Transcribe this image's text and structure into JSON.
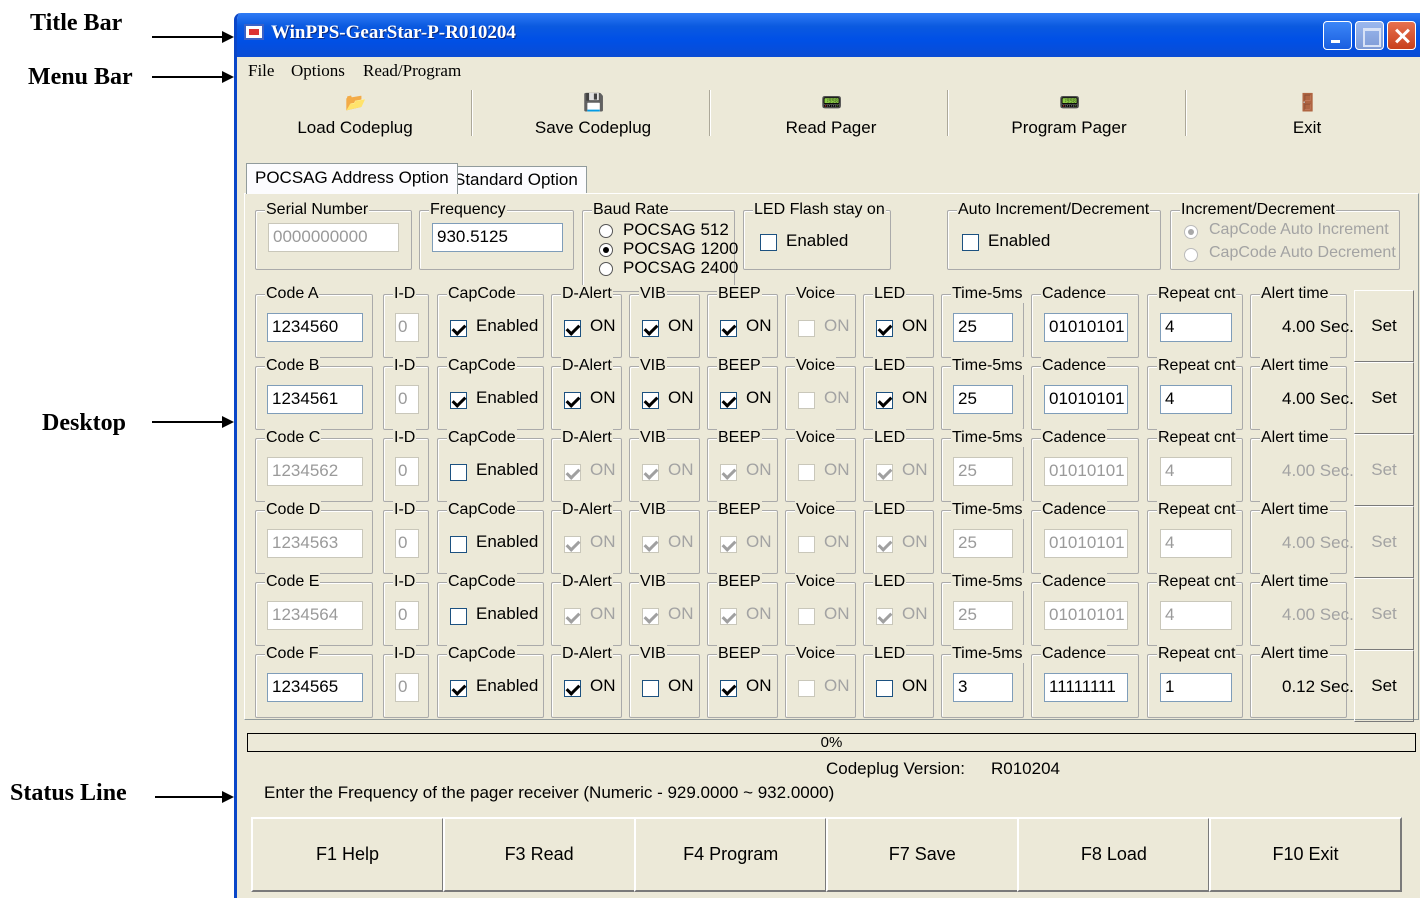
{
  "annotations": {
    "title_bar": "Title Bar",
    "menu_bar": "Menu Bar",
    "desktop": "Desktop",
    "status_line": "Status Line"
  },
  "window": {
    "title": "WinPPS-GearStar-P-R010204"
  },
  "menu": {
    "file": "File",
    "options": "Options",
    "read_program": "Read/Program"
  },
  "toolbar": {
    "load": "Load Codeplug",
    "save": "Save Codeplug",
    "read": "Read Pager",
    "program": "Program Pager",
    "exit": "Exit"
  },
  "tabs": {
    "pocsag": "POCSAG Address Option",
    "standard": "Standard Option"
  },
  "settings": {
    "serial_label": "Serial Number",
    "serial_value": "0000000000",
    "frequency_label": "Frequency",
    "frequency_value": "930.5125",
    "baud_label": "Baud Rate",
    "baud_options": [
      "POCSAG 512",
      "POCSAG 1200",
      "POCSAG 2400"
    ],
    "baud_selected": "POCSAG 1200",
    "led_label": "LED Flash stay on",
    "led_text": "Enabled",
    "led_enabled": false,
    "auto_label": "Auto Increment/Decrement",
    "auto_text": "Enabled",
    "auto_enabled": false,
    "incdec_label": "Increment/Decrement",
    "incdec_options": [
      "CapCode Auto Increment",
      "CapCode Auto Decrement"
    ],
    "incdec_selected": "CapCode Auto Increment"
  },
  "columns": {
    "id": "I-D",
    "capcode": "CapCode",
    "dalert": "D-Alert",
    "vib": "VIB",
    "beep": "BEEP",
    "voice": "Voice",
    "led": "LED",
    "time": "Time-5ms",
    "cadence": "Cadence",
    "repeat": "Repeat cnt",
    "alert": "Alert time"
  },
  "check_labels": {
    "enabled": "Enabled",
    "on": "ON"
  },
  "set_label": "Set",
  "codes": [
    {
      "label": "Code A",
      "value": "1234560",
      "id": "0",
      "capcode": true,
      "dalert": true,
      "vib": true,
      "beep": true,
      "voice": false,
      "led": true,
      "time": "25",
      "cadence": "01010101",
      "repeat": "4",
      "alert": "4.00 Sec."
    },
    {
      "label": "Code B",
      "value": "1234561",
      "id": "0",
      "capcode": true,
      "dalert": true,
      "vib": true,
      "beep": true,
      "voice": false,
      "led": true,
      "time": "25",
      "cadence": "01010101",
      "repeat": "4",
      "alert": "4.00 Sec."
    },
    {
      "label": "Code C",
      "value": "1234562",
      "id": "0",
      "capcode": false,
      "dalert": true,
      "vib": true,
      "beep": true,
      "voice": false,
      "led": true,
      "time": "25",
      "cadence": "01010101",
      "repeat": "4",
      "alert": "4.00 Sec."
    },
    {
      "label": "Code D",
      "value": "1234563",
      "id": "0",
      "capcode": false,
      "dalert": true,
      "vib": true,
      "beep": true,
      "voice": false,
      "led": true,
      "time": "25",
      "cadence": "01010101",
      "repeat": "4",
      "alert": "4.00 Sec."
    },
    {
      "label": "Code E",
      "value": "1234564",
      "id": "0",
      "capcode": false,
      "dalert": true,
      "vib": true,
      "beep": true,
      "voice": false,
      "led": true,
      "time": "25",
      "cadence": "01010101",
      "repeat": "4",
      "alert": "4.00 Sec."
    },
    {
      "label": "Code F",
      "value": "1234565",
      "id": "0",
      "capcode": true,
      "dalert": true,
      "vib": false,
      "beep": true,
      "voice": false,
      "led": false,
      "time": "3",
      "cadence": "11111111",
      "repeat": "1",
      "alert": "0.12 Sec."
    }
  ],
  "status": {
    "progress": "0%",
    "progress_fraction": 0,
    "codeplug_label": "Codeplug Version:",
    "codeplug_value": "R010204",
    "message": "Enter the Frequency of the pager receiver (Numeric - 929.0000 ~ 932.0000)"
  },
  "function_keys": [
    "F1 Help",
    "F3 Read",
    "F4 Program",
    "F7 Save",
    "F8 Load",
    "F10 Exit"
  ]
}
